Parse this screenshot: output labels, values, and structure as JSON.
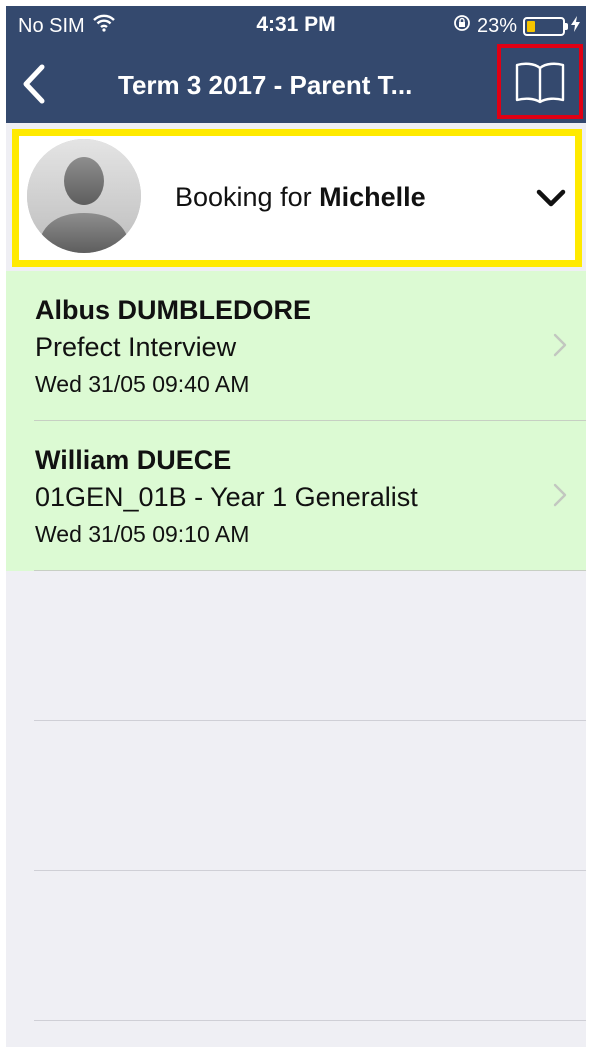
{
  "status_bar": {
    "carrier": "No SIM",
    "time": "4:31 PM",
    "battery": "23%",
    "battery_level": 0.23,
    "icons": [
      "wifi-icon",
      "rotation-lock-icon",
      "battery-icon",
      "charging-icon"
    ]
  },
  "nav": {
    "title": "Term 3 2017 - Parent T...",
    "back_icon": "chevron-left-icon",
    "book_icon": "book-icon"
  },
  "booking": {
    "prefix": "Booking for ",
    "student_name": "Michelle",
    "avatar_icon": "person-silhouette-icon",
    "dropdown_icon": "chevron-down-icon"
  },
  "appointments": [
    {
      "teacher": "Albus DUMBLEDORE",
      "subject": "Prefect Interview",
      "time": "Wed 31/05 09:40 AM"
    },
    {
      "teacher": "William DUECE",
      "subject": "01GEN_01B - Year 1 Generalist",
      "time": "Wed 31/05 09:10 AM"
    }
  ],
  "colors": {
    "nav_background": "#34496e",
    "row_background": "#dcfad3",
    "list_background": "#efeff4",
    "selector_highlight": "#ffea00",
    "book_highlight": "#e00014",
    "battery_fill": "#f5c400"
  }
}
